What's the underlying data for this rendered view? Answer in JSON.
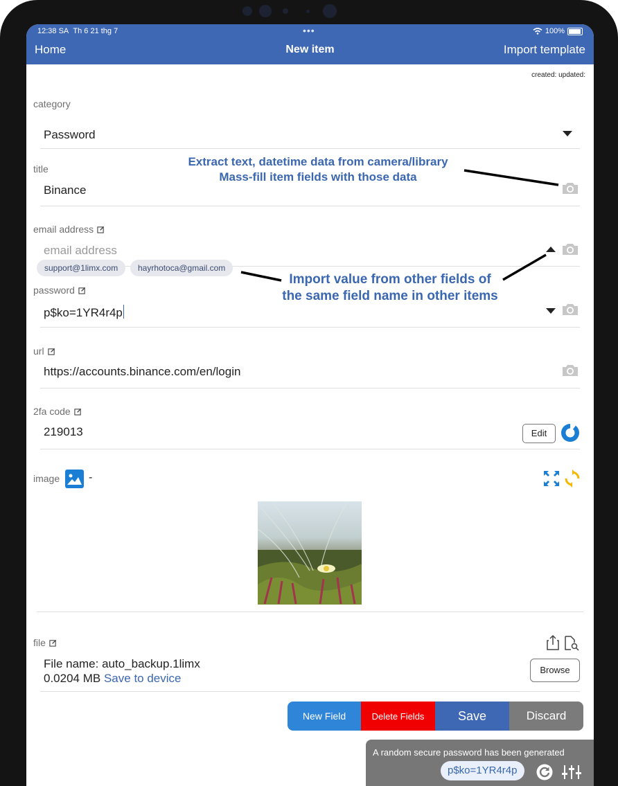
{
  "status_bar": {
    "time": "12:38 SA",
    "date": "Th 6 21 thg 7",
    "battery": "100%"
  },
  "nav": {
    "back_label": "Home",
    "title": "New item",
    "action_label": "Import template"
  },
  "meta_text": "created: updated:",
  "fields": {
    "category": {
      "label": "category",
      "value": "Password"
    },
    "title": {
      "label": "title",
      "value": "Binance"
    },
    "email": {
      "label": "email address",
      "placeholder": "email address",
      "suggestions": [
        "support@1limx.com",
        "hayrhotoca@gmail.com"
      ]
    },
    "password": {
      "label": "password",
      "value": "p$ko=1YR4r4p"
    },
    "url": {
      "label": "url",
      "value": "https://accounts.binance.com/en/login"
    },
    "twofa": {
      "label": "2fa code",
      "value": "219013",
      "edit_label": "Edit"
    },
    "image": {
      "label": "image",
      "separator": "-"
    },
    "file": {
      "label": "file",
      "name_text": "File name: auto_backup.1limx",
      "size_text": "0.0204 MB",
      "save_link": "Save to device",
      "browse_label": "Browse"
    }
  },
  "annotations": {
    "camera_line1": "Extract text, datetime data from camera/library",
    "camera_line2": "Mass-fill item fields with those data",
    "import_line1": "Import value from other fields of",
    "import_line2": "the same field name in other items"
  },
  "actions": {
    "new_field": "New Field",
    "delete_fields": "Delete Fields",
    "save": "Save",
    "discard": "Discard"
  },
  "toast": {
    "message": "A random secure password has been generated",
    "password": "p$ko=1YR4r4p"
  },
  "colors": {
    "nav_bar": "#3f68b4",
    "new_field": "#2f86d8",
    "delete_fields": "#f00000",
    "save": "#3f68b4",
    "discard": "#7b7b7b",
    "annotation": "#3a67b0"
  }
}
